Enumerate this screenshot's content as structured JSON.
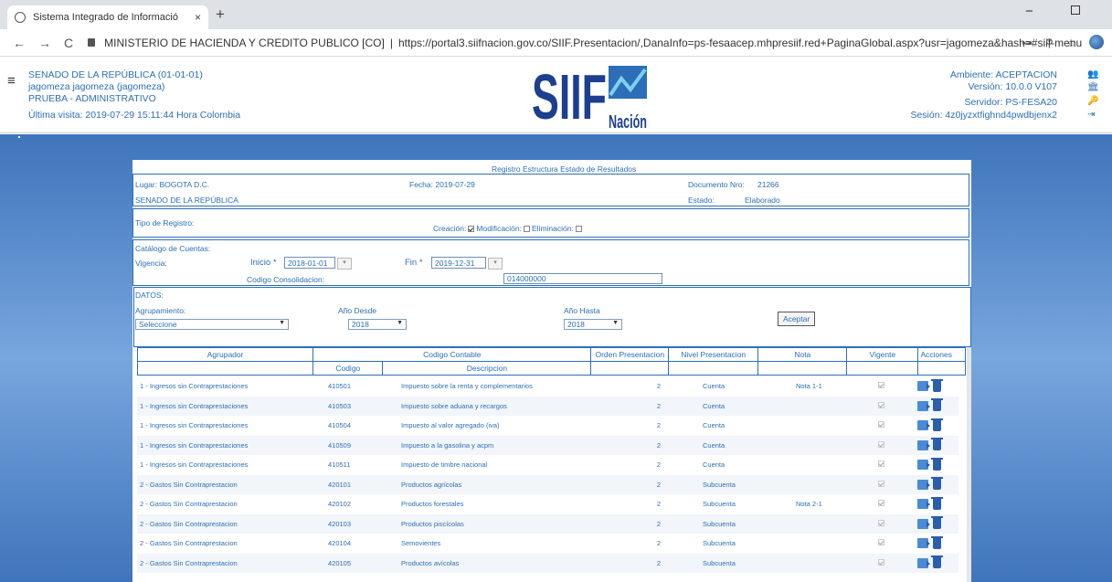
{
  "browser": {
    "tab_title": "Sistema Integrado de Informació",
    "tab_close": "×",
    "new_tab": "+",
    "address_prefix": "MINISTERIO DE HACIENDA Y CREDITO PUBLICO [CO]",
    "address_sep": "|",
    "address_host": "https://portal3.siifnacion.gov.co",
    "address_path": "/SIIF.Presentacion/,DanaInfo=ps-fesaacep.mhpresiif.red+PaginaGlobal.aspx?usr=jagomeza&hash=#siif-menu",
    "minimize": "−"
  },
  "header": {
    "entity": "SENADO DE LA REPÚBLICA (01-01-01)",
    "user": "jagomeza jagomeza (jagomeza)",
    "profile": "PRUEBA - ADMINISTRATIVO",
    "last_visit": "Última visita: 2019-07-29 15:11:44 Hora Colombia",
    "environment": "Ambiente: ACEPTACION",
    "version": "Versión: 10.0.0 V107",
    "server": "Servidor: PS-FESA20",
    "session": "Sesión: 4z0jyzxtfighnd4pwdbjenx2",
    "logo_text": "SIIF",
    "logo_sub": "Nación"
  },
  "form": {
    "title": "Registro Estructura Estado de Resultados",
    "lugar": "Lugar: BOGOTA D.C.",
    "fecha": "Fecha: 2019-07-29",
    "doc_label": "Documento Nro:",
    "doc_value": "21266",
    "entidad": "SENADO DE LA REPÚBLICA",
    "estado_label": "Estado:",
    "estado_value": "Elaborado",
    "tipo_registro": "Tipo de Registro:",
    "creacion": "Creación:",
    "modificacion": "Modificación:",
    "eliminacion": "Eliminación:",
    "catalogo": "Catálogo de Cuentas:",
    "vigencia": "Vigencia:",
    "inicio_label": "Inicio *",
    "inicio_value": "2018-01-01",
    "fin_label": "Fin *",
    "fin_value": "2019-12-31",
    "cod_consol_label": "Codigo Consolidacion:",
    "cod_consol_value": "014000000",
    "datos": "DATOS:",
    "agrupamiento": "Agrupamiento:",
    "agrupamiento_value": "Seleccione",
    "anio_desde": "Año Desde",
    "anio_desde_value": "2018",
    "anio_hasta": "Año Hasta",
    "anio_hasta_value": "2018",
    "aceptar": "Aceptar"
  },
  "grid": {
    "h_agrupador": "Agrupador",
    "h_codigo_contable": "Codigo Contable",
    "h_orden": "Orden Presentacion",
    "h_nivel": "Nivel Presentacion",
    "h_nota": "Nota",
    "h_vigente": "Vigente",
    "h_acciones": "Acciones",
    "h_codigo": "Codigo",
    "h_descripcion": "Descripcion",
    "rows": [
      {
        "agrupador": "1 - Ingresos sin Contraprestaciones",
        "codigo": "410501",
        "descripcion": "Impuesto sobre la renta y complementarios",
        "orden": "2",
        "nivel": "Cuenta",
        "nota": "Nota 1-1"
      },
      {
        "agrupador": "1 - Ingresos sin Contraprestaciones",
        "codigo": "410503",
        "descripcion": "Impuesto sobre aduana y recargos",
        "orden": "2",
        "nivel": "Cuenta",
        "nota": ""
      },
      {
        "agrupador": "1 - Ingresos sin Contraprestaciones",
        "codigo": "410504",
        "descripcion": "Impuesto al valor agregado (iva)",
        "orden": "2",
        "nivel": "Cuenta",
        "nota": ""
      },
      {
        "agrupador": "1 - Ingresos sin Contraprestaciones",
        "codigo": "410509",
        "descripcion": "Impuesto a la gasolina y acpm",
        "orden": "2",
        "nivel": "Cuenta",
        "nota": ""
      },
      {
        "agrupador": "1 - Ingresos sin Contraprestaciones",
        "codigo": "410511",
        "descripcion": "Impuesto de timbre nacional",
        "orden": "2",
        "nivel": "Cuenta",
        "nota": ""
      },
      {
        "agrupador": "2 - Gastos Sin Contraprestacion",
        "codigo": "420101",
        "descripcion": "Productos agrícolas",
        "orden": "2",
        "nivel": "Subcuenta",
        "nota": ""
      },
      {
        "agrupador": "2 - Gastos Sin Contraprestacion",
        "codigo": "420102",
        "descripcion": "Productos forestales",
        "orden": "2",
        "nivel": "Subcuenta",
        "nota": "Nota 2-1"
      },
      {
        "agrupador": "2 - Gastos Sin Contraprestacion",
        "codigo": "420103",
        "descripcion": "Productos piscícolas",
        "orden": "2",
        "nivel": "Subcuenta",
        "nota": ""
      },
      {
        "agrupador": "2 - Gastos Sin Contraprestacion",
        "codigo": "420104",
        "descripcion": "Semovientes",
        "orden": "2",
        "nivel": "Subcuenta",
        "nota": ""
      },
      {
        "agrupador": "2 - Gastos Sin Contraprestacion",
        "codigo": "420105",
        "descripcion": "Productos avícolas",
        "orden": "2",
        "nivel": "Subcuenta",
        "nota": ""
      }
    ]
  }
}
